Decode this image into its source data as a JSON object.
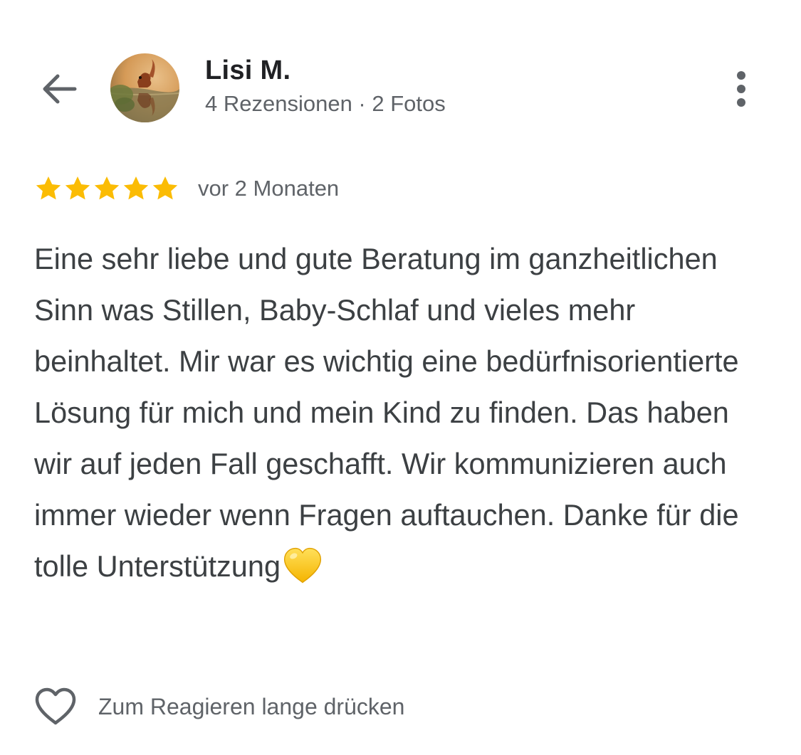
{
  "reviewer": {
    "name": "Lisi M.",
    "meta": "4 Rezensionen · 2 Fotos"
  },
  "review": {
    "rating": 5,
    "max_rating": 5,
    "date": "vor 2 Monaten",
    "text": "Eine sehr liebe und gute Beratung im ganzheitlichen Sinn was Stillen, Baby-Schlaf und vieles mehr beinhaltet. Mir war es wichtig eine bedürfnisorientierte Lösung für mich und mein Kind zu finden. Das haben wir auf jeden Fall geschafft. Wir kommunizieren auch immer wieder wenn Fragen auftauchen. Danke für die tolle Unterstützung",
    "trailing_emoji": "yellow-heart"
  },
  "reaction": {
    "hint": "Zum Reagieren lange drücken"
  },
  "colors": {
    "star": "#fbbc04",
    "text_primary": "#202124",
    "text_body": "#3c4043",
    "text_secondary": "#5f6368",
    "emoji_heart": "#fdc324"
  },
  "icons": {
    "back": "arrow-back-icon",
    "more": "more-vert-icon",
    "react": "heart-outline-icon"
  }
}
